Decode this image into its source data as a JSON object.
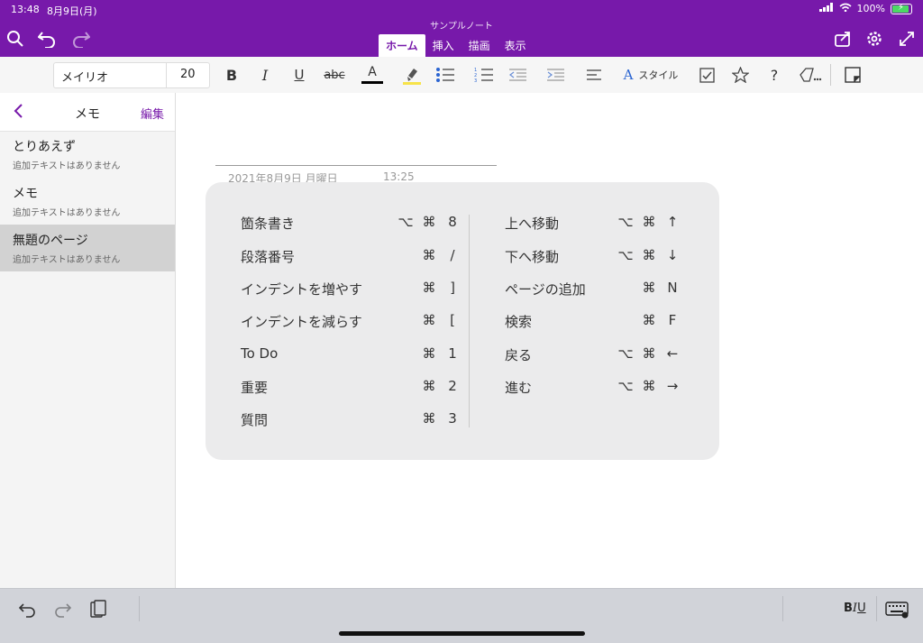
{
  "status_bar": {
    "time": "13:48",
    "date": "8月9日(月)",
    "battery": "100%"
  },
  "app": {
    "notebook_title": "サンプルノート",
    "accent": "#7719aa"
  },
  "tabs": [
    {
      "label": "ホーム",
      "active": true
    },
    {
      "label": "挿入",
      "active": false
    },
    {
      "label": "描画",
      "active": false
    },
    {
      "label": "表示",
      "active": false
    }
  ],
  "ribbon": {
    "font_name": "メイリオ",
    "font_size": "20",
    "bold": "B",
    "italic": "I",
    "underline": "U",
    "strike": "abc",
    "font_color": "A",
    "style_label": "スタイル",
    "help": "?"
  },
  "sidebar": {
    "back_icon": "chevron-left-icon",
    "title": "メモ",
    "edit_label": "編集",
    "pages": [
      {
        "title": "とりあえず",
        "subtitle": "追加テキストはありません",
        "selected": false
      },
      {
        "title": "メモ",
        "subtitle": "追加テキストはありません",
        "selected": false
      },
      {
        "title": "無題のページ",
        "subtitle": "追加テキストはありません",
        "selected": true
      }
    ]
  },
  "page": {
    "date": "2021年8月9日 月曜日",
    "time": "13:25"
  },
  "shortcuts": {
    "left": [
      {
        "label": "箇条書き",
        "keys": [
          "⌥",
          "⌘",
          "8"
        ]
      },
      {
        "label": "段落番号",
        "keys": [
          "⌘",
          "/"
        ]
      },
      {
        "label": "インデントを増やす",
        "keys": [
          "⌘",
          "]"
        ]
      },
      {
        "label": "インデントを減らす",
        "keys": [
          "⌘",
          "["
        ]
      },
      {
        "label": "To Do",
        "keys": [
          "⌘",
          "1"
        ]
      },
      {
        "label": "重要",
        "keys": [
          "⌘",
          "2"
        ]
      },
      {
        "label": "質問",
        "keys": [
          "⌘",
          "3"
        ]
      }
    ],
    "right": [
      {
        "label": "上へ移動",
        "keys": [
          "⌥",
          "⌘",
          "↑"
        ]
      },
      {
        "label": "下へ移動",
        "keys": [
          "⌥",
          "⌘",
          "↓"
        ]
      },
      {
        "label": "ページの追加",
        "keys": [
          "⌘",
          "N"
        ]
      },
      {
        "label": "検索",
        "keys": [
          "⌘",
          "F"
        ]
      },
      {
        "label": "戻る",
        "keys": [
          "⌥",
          "⌘",
          "←"
        ]
      },
      {
        "label": "進む",
        "keys": [
          "⌥",
          "⌘",
          "→"
        ]
      }
    ]
  },
  "bottom_bar": {
    "biu": "BIU"
  }
}
